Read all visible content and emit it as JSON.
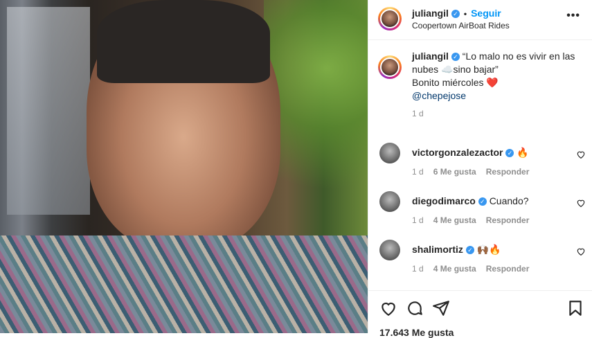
{
  "post": {
    "username": "juliangil",
    "follow_label": "Seguir",
    "location": "Coopertown AirBoat Rides",
    "more_label": "•••",
    "caption": {
      "line1": "“Lo malo no es vivir en las nubes ☁️sino bajar”",
      "line2": "Bonito miércoles ❤️",
      "mention": "@chepejose",
      "time": "1 d"
    },
    "comments": [
      {
        "username": "victorgonzalezactor",
        "text": "🔥",
        "time": "1 d",
        "likes": "6 Me gusta",
        "reply": "Responder"
      },
      {
        "username": "diegodimarco",
        "text": "Cuando?",
        "time": "1 d",
        "likes": "4 Me gusta",
        "reply": "Responder"
      },
      {
        "username": "shalimortiz",
        "text": "🙌🏾🔥",
        "time": "1 d",
        "likes": "4 Me gusta",
        "reply": "Responder"
      }
    ],
    "likes_count": "17.643 Me gusta"
  },
  "colors": {
    "accent": "#0095f6",
    "verified": "#3897f0",
    "muted": "#8e8e8e"
  },
  "icons": [
    "heart-icon",
    "comment-icon",
    "share-icon",
    "bookmark-icon",
    "verified-icon",
    "more-icon"
  ]
}
